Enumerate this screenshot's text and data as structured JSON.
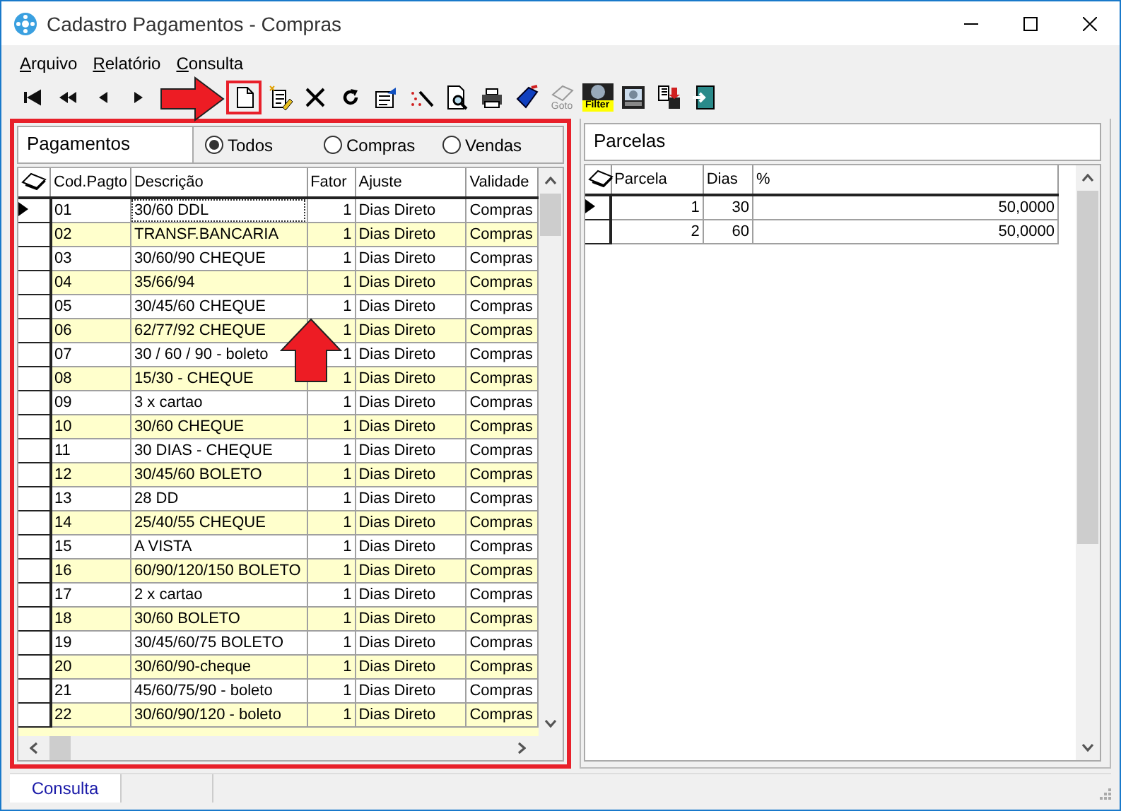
{
  "window": {
    "title": "Cadastro Pagamentos - Compras"
  },
  "menu": [
    {
      "label": "Arquivo"
    },
    {
      "label": "Relatório"
    },
    {
      "label": "Consulta"
    }
  ],
  "toolbar": [
    {
      "kind": "first",
      "highlighted": false
    },
    {
      "kind": "prev-page",
      "highlighted": false
    },
    {
      "kind": "prev",
      "highlighted": false
    },
    {
      "kind": "next",
      "highlighted": false
    },
    {
      "kind": "new",
      "highlighted": true
    },
    {
      "kind": "edit",
      "highlighted": false
    },
    {
      "kind": "delete",
      "highlighted": false
    },
    {
      "kind": "refresh",
      "highlighted": false
    },
    {
      "kind": "properties",
      "highlighted": false
    },
    {
      "kind": "wand",
      "highlighted": false
    },
    {
      "kind": "preview",
      "highlighted": false
    },
    {
      "kind": "print",
      "highlighted": false
    },
    {
      "kind": "tag",
      "highlighted": false
    },
    {
      "kind": "goto",
      "label": "Goto",
      "highlighted": false
    },
    {
      "kind": "filter",
      "label": "Filter",
      "highlighted": false
    },
    {
      "kind": "screen",
      "highlighted": false
    },
    {
      "kind": "save",
      "highlighted": false
    },
    {
      "kind": "exit",
      "highlighted": false
    }
  ],
  "pagamentos": {
    "title": "Pagamentos",
    "filters": [
      {
        "label": "Todos",
        "selected": true
      },
      {
        "label": "Compras",
        "selected": false
      },
      {
        "label": "Vendas",
        "selected": false
      }
    ],
    "columns": [
      "Cod.Pagto",
      "Descrição",
      "Fator",
      "Ajuste",
      "Validade"
    ],
    "rows": [
      {
        "cells": [
          "01",
          "30/60 DDL",
          "1",
          "Dias Direto",
          "Compras"
        ],
        "selected": true
      },
      {
        "cells": [
          "02",
          "TRANSF.BANCARIA",
          "1",
          "Dias Direto",
          "Compras"
        ],
        "selected": false
      },
      {
        "cells": [
          "03",
          "30/60/90 CHEQUE",
          "1",
          "Dias Direto",
          "Compras"
        ],
        "selected": false
      },
      {
        "cells": [
          "04",
          "35/66/94",
          "1",
          "Dias Direto",
          "Compras"
        ],
        "selected": false
      },
      {
        "cells": [
          "05",
          "30/45/60 CHEQUE",
          "1",
          "Dias Direto",
          "Compras"
        ],
        "selected": false
      },
      {
        "cells": [
          "06",
          "62/77/92 CHEQUE",
          "1",
          "Dias Direto",
          "Compras"
        ],
        "selected": false
      },
      {
        "cells": [
          "07",
          "30 / 60 / 90 - boleto",
          "1",
          "Dias Direto",
          "Compras"
        ],
        "selected": false
      },
      {
        "cells": [
          "08",
          "15/30 - CHEQUE",
          "1",
          "Dias Direto",
          "Compras"
        ],
        "selected": false
      },
      {
        "cells": [
          "09",
          "3 x cartao",
          "1",
          "Dias Direto",
          "Compras"
        ],
        "selected": false
      },
      {
        "cells": [
          "10",
          "30/60 CHEQUE",
          "1",
          "Dias Direto",
          "Compras"
        ],
        "selected": false
      },
      {
        "cells": [
          "11",
          "30 DIAS - CHEQUE",
          "1",
          "Dias Direto",
          "Compras"
        ],
        "selected": false
      },
      {
        "cells": [
          "12",
          "30/45/60 BOLETO",
          "1",
          "Dias Direto",
          "Compras"
        ],
        "selected": false
      },
      {
        "cells": [
          "13",
          "28 DD",
          "1",
          "Dias Direto",
          "Compras"
        ],
        "selected": false
      },
      {
        "cells": [
          "14",
          "25/40/55 CHEQUE",
          "1",
          "Dias Direto",
          "Compras"
        ],
        "selected": false
      },
      {
        "cells": [
          "15",
          "A VISTA",
          "1",
          "Dias Direto",
          "Compras"
        ],
        "selected": false
      },
      {
        "cells": [
          "16",
          "60/90/120/150 BOLETO",
          "1",
          "Dias Direto",
          "Compras"
        ],
        "selected": false
      },
      {
        "cells": [
          "17",
          "2 x cartao",
          "1",
          "Dias Direto",
          "Compras"
        ],
        "selected": false
      },
      {
        "cells": [
          "18",
          "30/60 BOLETO",
          "1",
          "Dias Direto",
          "Compras"
        ],
        "selected": false
      },
      {
        "cells": [
          "19",
          "30/45/60/75 BOLETO",
          "1",
          "Dias Direto",
          "Compras"
        ],
        "selected": false
      },
      {
        "cells": [
          "20",
          "30/60/90-cheque",
          "1",
          "Dias Direto",
          "Compras"
        ],
        "selected": false
      },
      {
        "cells": [
          "21",
          "45/60/75/90 - boleto",
          "1",
          "Dias Direto",
          "Compras"
        ],
        "selected": false
      },
      {
        "cells": [
          "22",
          "30/60/90/120 - boleto",
          "1",
          "Dias Direto",
          "Compras"
        ],
        "selected": false
      }
    ]
  },
  "parcelas": {
    "title": "Parcelas",
    "columns": [
      "Parcela",
      "Dias",
      "%"
    ],
    "rows": [
      {
        "cells": [
          "1",
          "30",
          "50,0000"
        ],
        "selected": true
      },
      {
        "cells": [
          "2",
          "60",
          "50,0000"
        ],
        "selected": false
      }
    ]
  },
  "status_bar": {
    "tabs": [
      {
        "label": "Consulta"
      }
    ]
  }
}
